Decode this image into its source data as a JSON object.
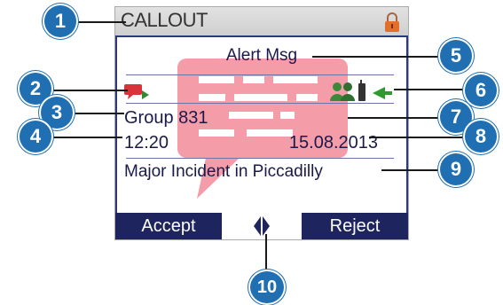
{
  "screen": {
    "title": "CALLOUT",
    "alert_label": "Alert Msg",
    "group": "Group 831",
    "time": "12:20",
    "date": "15.08.2013",
    "message": "Major Incident in Piccadilly",
    "softkeys": {
      "left": "Accept",
      "right": "Reject"
    }
  },
  "callouts": [
    "1",
    "2",
    "3",
    "4",
    "5",
    "6",
    "7",
    "8",
    "9",
    "10"
  ],
  "colors": {
    "callout_fill": "#1f6fb2",
    "softkey_bar": "#1d245e",
    "bubble": "#f28c9a",
    "lock": "#d9534f"
  }
}
